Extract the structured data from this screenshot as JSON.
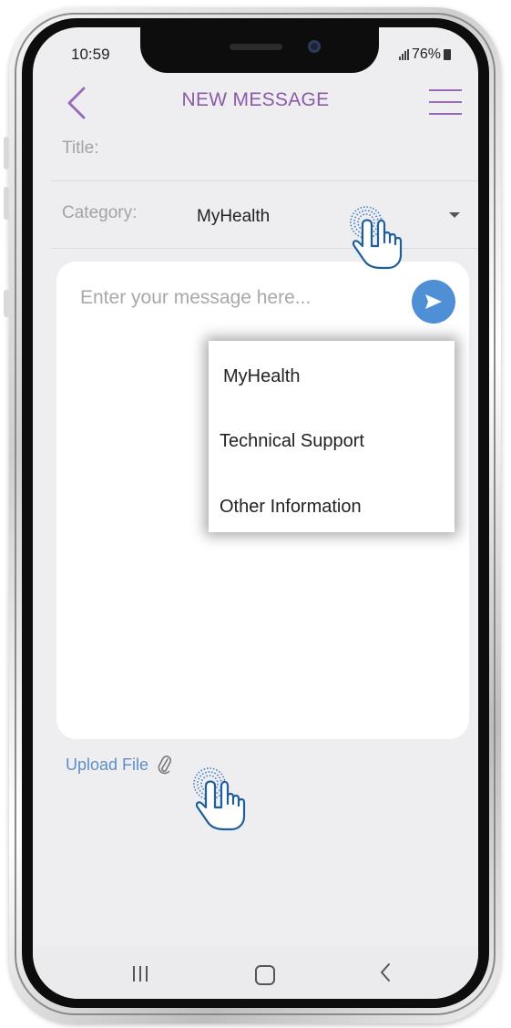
{
  "status_bar": {
    "time": "10:59",
    "battery": "76%"
  },
  "header": {
    "title": "NEW MESSAGE"
  },
  "form": {
    "title_label": "Title:",
    "category_label": "Category:",
    "category_value": "MyHealth",
    "message_placeholder": "Enter your message here..."
  },
  "category_options": [
    "MyHealth",
    "Technical Support",
    "Other Information"
  ],
  "upload": {
    "label": "Upload File"
  },
  "colors": {
    "accent": "#8b5aa8",
    "send": "#4e8fd6",
    "link": "#5b8fc5"
  },
  "icons": [
    "back-icon",
    "hamburger-menu-icon",
    "dropdown-arrow-icon",
    "send-icon",
    "paperclip-icon",
    "tap-hand-icon",
    "nav-recents-icon",
    "nav-home-icon",
    "nav-back-icon"
  ]
}
